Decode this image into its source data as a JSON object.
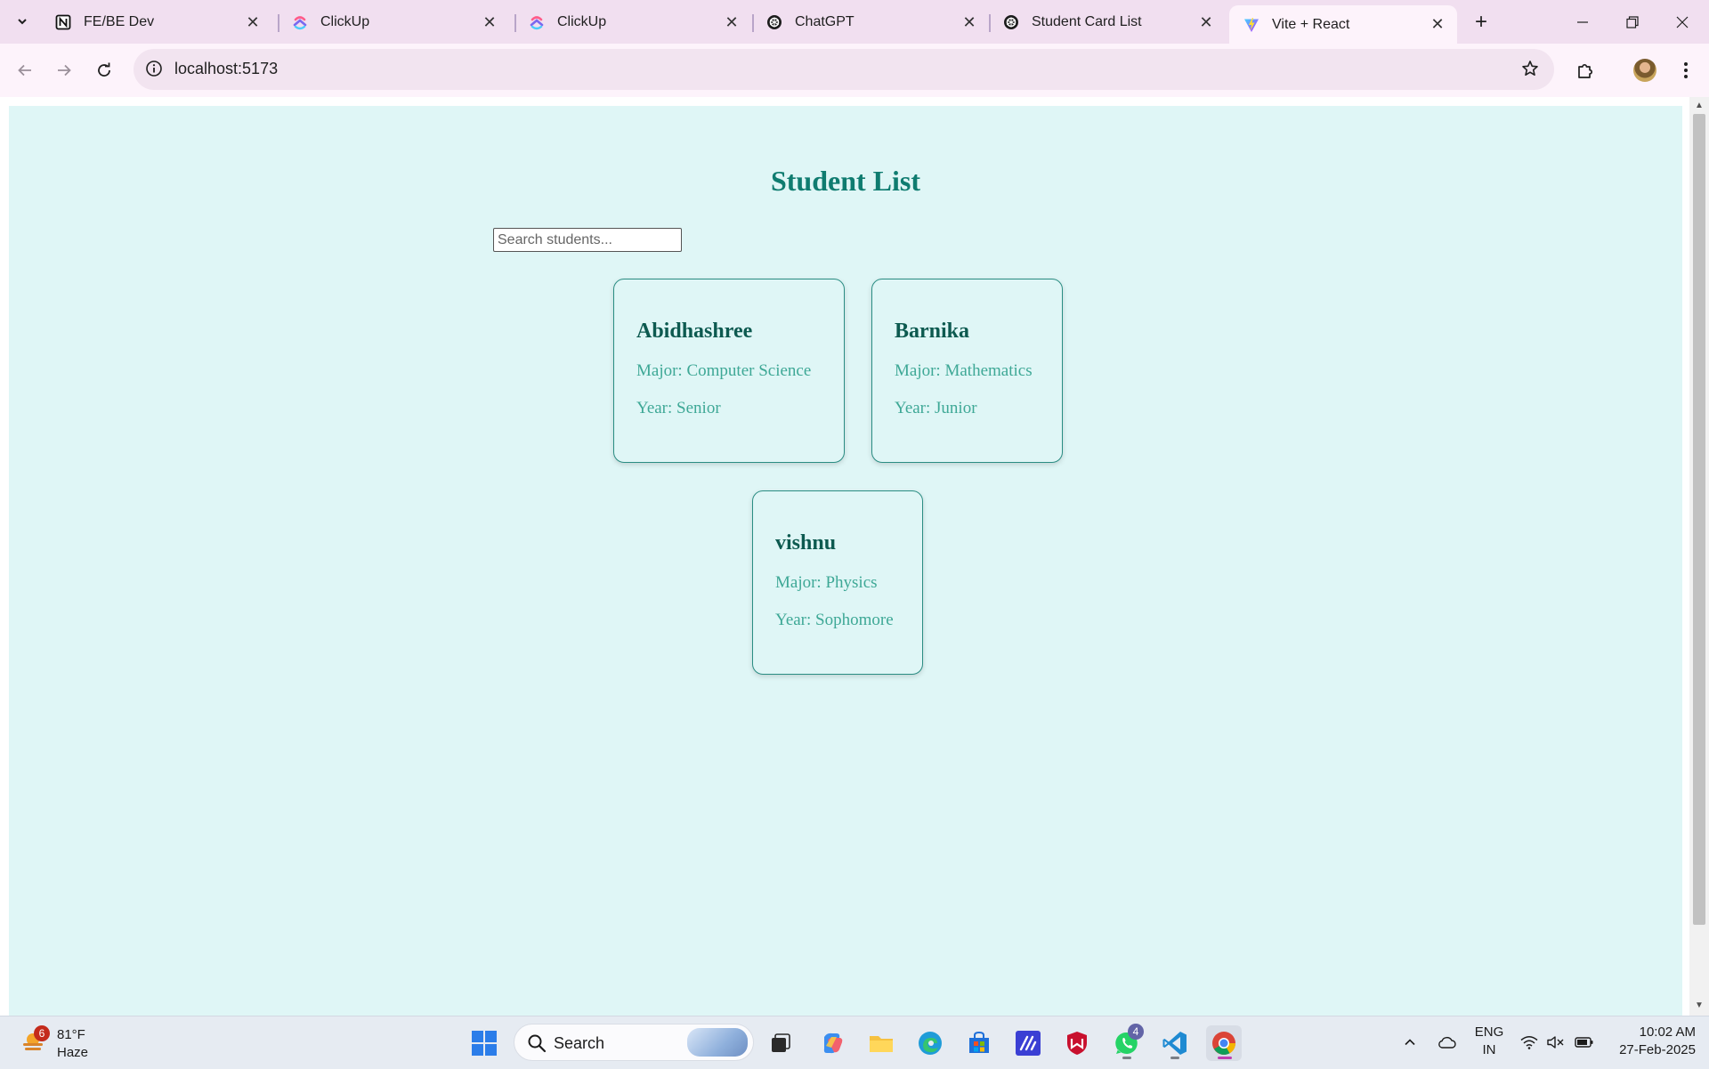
{
  "browser": {
    "tabs": [
      {
        "title": "FE/BE Dev",
        "icon": "notion-icon",
        "active": false
      },
      {
        "title": "ClickUp",
        "icon": "clickup-icon",
        "active": false
      },
      {
        "title": "ClickUp",
        "icon": "clickup-icon",
        "active": false
      },
      {
        "title": "ChatGPT",
        "icon": "chatgpt-icon",
        "active": false
      },
      {
        "title": "Student Card List",
        "icon": "chatgpt-icon",
        "active": false
      },
      {
        "title": "Vite + React",
        "icon": "vite-icon",
        "active": true
      }
    ],
    "url": "localhost:5173"
  },
  "page": {
    "title": "Student List",
    "search_placeholder": "Search students...",
    "students": [
      {
        "name": "Abidhashree",
        "major": "Major: Computer Science",
        "year": "Year: Senior"
      },
      {
        "name": "Barnika",
        "major": "Major: Mathematics",
        "year": "Year: Junior"
      },
      {
        "name": "vishnu",
        "major": "Major: Physics",
        "year": "Year: Sophomore"
      }
    ]
  },
  "taskbar": {
    "weather_badge": "6",
    "temperature": "81°F",
    "condition": "Haze",
    "search_label": "Search",
    "whatsapp_badge": "4",
    "language_line1": "ENG",
    "language_line2": "IN",
    "time": "10:02 AM",
    "date": "27-Feb-2025"
  },
  "colors": {
    "page_background": "#dff6f6",
    "title_color": "#0f7c70",
    "card_border": "#2a8d83",
    "card_name": "#0d5a50",
    "card_text": "#3ea896",
    "tabbar_background": "#f1dff0"
  }
}
